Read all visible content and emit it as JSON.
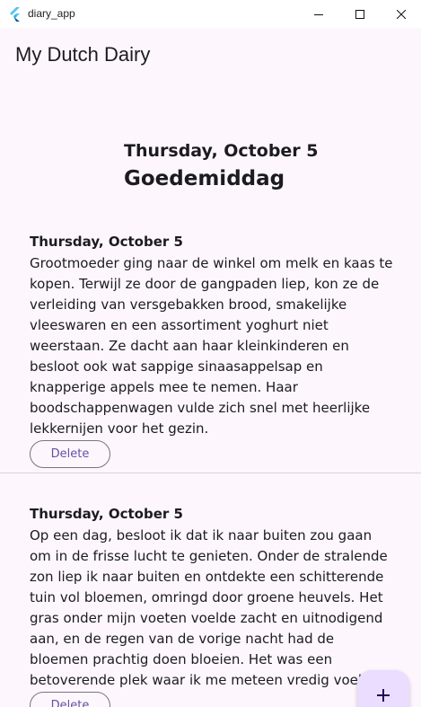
{
  "window": {
    "title": "diary_app",
    "icon": "flutter-logo-icon",
    "controls": [
      "minimize-icon",
      "maximize-icon",
      "close-icon"
    ]
  },
  "appbar": {
    "title": "My Dutch Dairy"
  },
  "header": {
    "date": "Thursday, October 5",
    "greeting": "Goedemiddag"
  },
  "entries": [
    {
      "date": "Thursday, October 5",
      "text": "Grootmoeder ging naar de winkel om melk en kaas te kopen. Terwijl ze door de gangpaden liep, kon ze de verleiding van versgebakken brood, smakelijke vleeswaren en een assortiment yoghurt niet weerstaan. Ze dacht aan haar kleinkinderen en besloot ook wat sappige sinaasappelsap en knapperige appels mee te nemen. Haar boodschappenwagen vulde zich snel met heerlijke lekkernijen voor het gezin.",
      "delete_label": "Delete"
    },
    {
      "date": "Thursday, October 5",
      "text": "Op een dag, besloot ik dat ik naar buiten zou gaan om in de frisse lucht te genieten. Onder de stralende zon liep ik naar buiten en ontdekte een schitterende tuin vol bloemen, omringd door groene heuvels. Het gras onder mijn voeten voelde zacht en uitnodigend aan, en de regen van de vorige nacht had de bloemen prachtig doen bloeien. Het was een betoverende plek waar ik me meteen vredig voelde.",
      "delete_label": "Delete"
    }
  ],
  "fab": {
    "icon": "add-icon"
  },
  "colors": {
    "background": "#fdf7fd",
    "accent": "#6750a4",
    "fab": "#eaddff",
    "outline": "#79747e",
    "flutter_blue": "#42a5f5"
  }
}
